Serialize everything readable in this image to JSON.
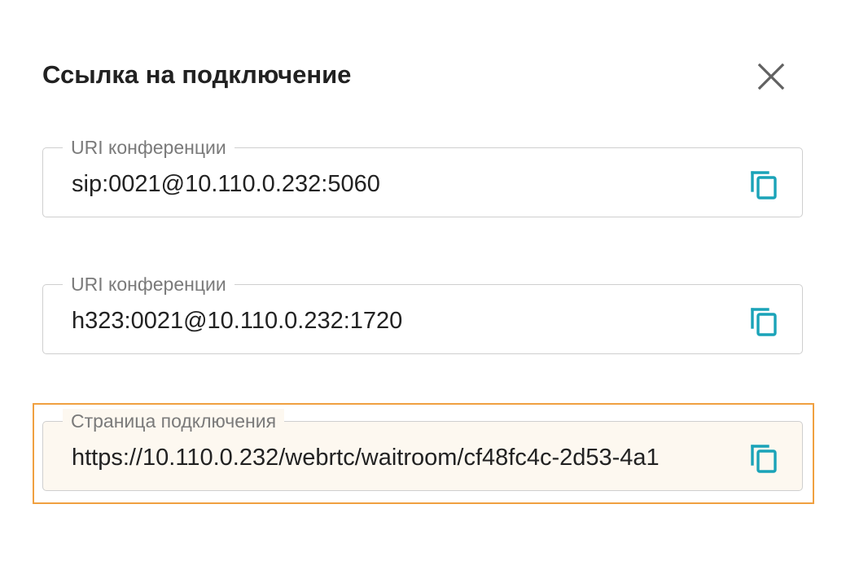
{
  "dialog": {
    "title": "Ссылка на подключение",
    "close_icon": "close-icon"
  },
  "fields": [
    {
      "label": "URI конференции",
      "value": "sip:0021@10.110.0.232:5060",
      "copy_icon": "copy-icon"
    },
    {
      "label": "URI конференции",
      "value": "h323:0021@10.110.0.232:1720",
      "copy_icon": "copy-icon"
    },
    {
      "label": "Страница подключения",
      "value": "https://10.110.0.232/webrtc/waitroom/cf48fc4c-2d53-4a1",
      "copy_icon": "copy-icon"
    }
  ],
  "colors": {
    "accent": "#1aa3b8",
    "highlight_border": "#f0a040",
    "highlight_fill": "#fdf8f0"
  }
}
